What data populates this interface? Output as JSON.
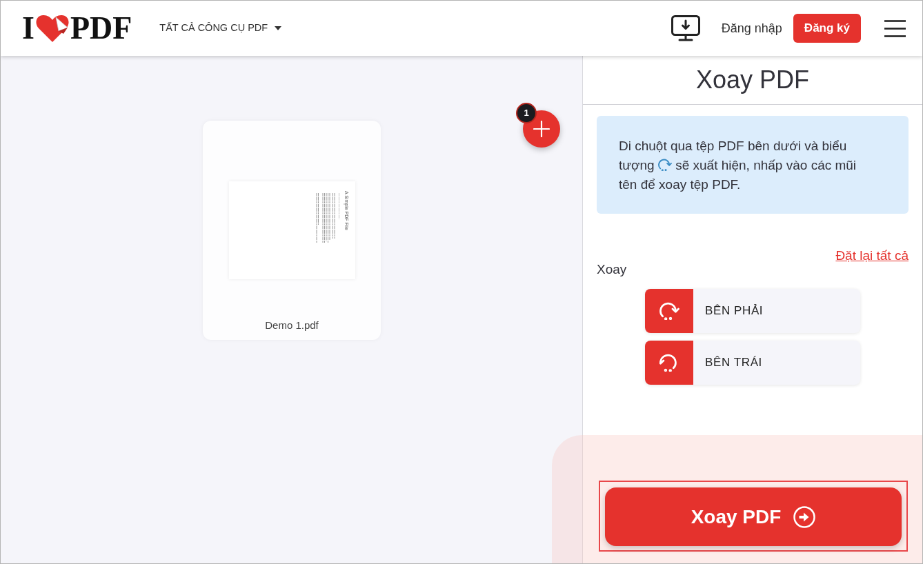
{
  "header": {
    "logo": {
      "letter": "I",
      "word": "PDF"
    },
    "tools_menu": "TẤT CẢ CÔNG CỤ PDF",
    "login": "Đăng nhập",
    "signup": "Đăng ký"
  },
  "workspace": {
    "files": [
      {
        "name": "Demo 1.pdf",
        "preview_title": "A Simple PDF File"
      }
    ],
    "add_button": {
      "badge": "1"
    }
  },
  "panel": {
    "title": "Xoay PDF",
    "info": {
      "text_before_icon": "Di chuột qua tệp PDF bên dưới và biểu tượng",
      "text_after_icon": "sẽ xuất hiện, nhấp vào các mũi tên để xoay tệp PDF."
    },
    "reset_link": "Đặt lại tất cả",
    "rotate_label": "Xoay",
    "rotate_options": [
      {
        "label": "BÊN PHẢI",
        "kind": "clockwise"
      },
      {
        "label": "BÊN TRÁI",
        "kind": "counterclockwise"
      }
    ],
    "submit": {
      "label": "Xoay PDF",
      "highlighted": true
    }
  }
}
